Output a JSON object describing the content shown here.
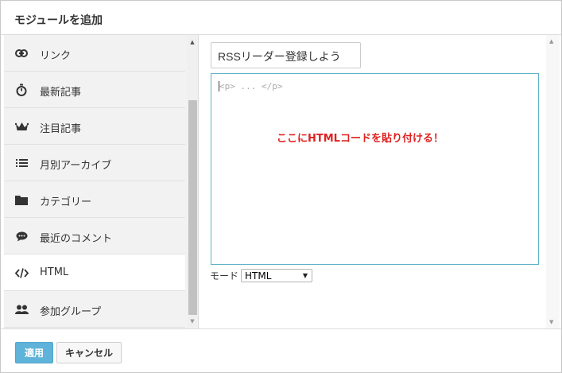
{
  "dialog": {
    "title": "モジュールを追加"
  },
  "sidebar": {
    "items": [
      {
        "label": "リンク",
        "icon": "link-icon"
      },
      {
        "label": "最新記事",
        "icon": "stopwatch-icon"
      },
      {
        "label": "注目記事",
        "icon": "crown-icon"
      },
      {
        "label": "月別アーカイブ",
        "icon": "list-icon"
      },
      {
        "label": "カテゴリー",
        "icon": "folder-icon"
      },
      {
        "label": "最近のコメント",
        "icon": "comment-icon"
      },
      {
        "label": "HTML",
        "icon": "code-icon",
        "active": true
      },
      {
        "label": "参加グループ",
        "icon": "group-icon"
      }
    ]
  },
  "main": {
    "title_value": "RSSリーダー登録しよう",
    "code_placeholder": "<p> ... </p>",
    "annotation": "ここにHTMLコードを貼り付ける！",
    "annotation_color": "#e02020",
    "mode_label": "モード",
    "mode_value": "HTML"
  },
  "footer": {
    "apply_label": "適用",
    "cancel_label": "キャンセル"
  },
  "colors": {
    "accent": "#5fb3d9",
    "code_border": "#5fb3c7"
  }
}
